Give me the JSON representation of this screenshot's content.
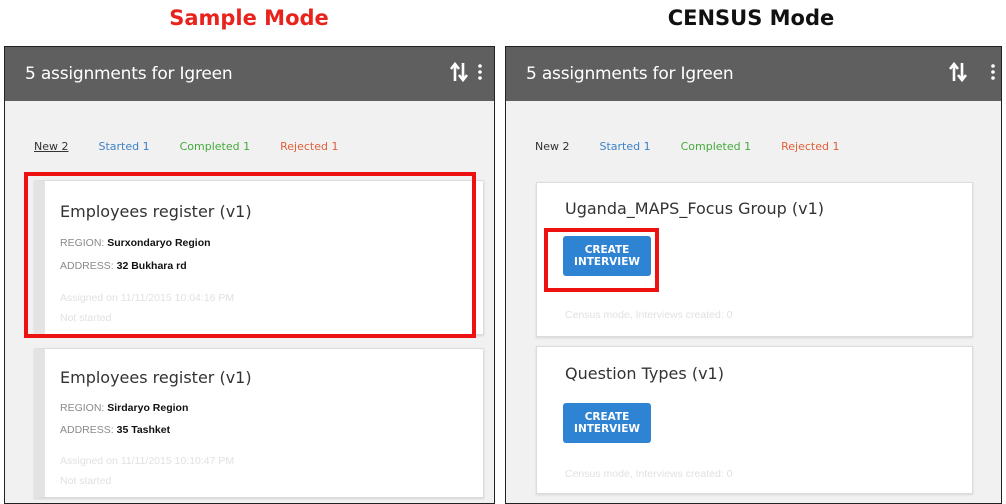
{
  "captions": {
    "sample": "Sample Mode",
    "census": "CENSUS Mode"
  },
  "colors": {
    "appbar": "#5f5f5f",
    "started": "#3c82c8",
    "completed": "#44aa3a",
    "rejected": "#e0603a",
    "button": "#2f83d3",
    "highlight": "#ee1111"
  },
  "sample": {
    "title": "5 assignments for Igreen",
    "tabs": {
      "new": "New 2",
      "started": "Started 1",
      "completed": "Completed 1",
      "rejected": "Rejected 1"
    },
    "cards": [
      {
        "title": "Employees register (v1)",
        "region_label": "REGION:",
        "region": "Surxondaryo Region",
        "address_label": "ADDRESS:",
        "address": "32 Bukhara rd",
        "assigned": "Assigned on 11/11/2015 10:04:16 PM",
        "status": "Not started"
      },
      {
        "title": "Employees register (v1)",
        "region_label": "REGION:",
        "region": "Sirdaryo Region",
        "address_label": "ADDRESS:",
        "address": "35 Tashket",
        "assigned": "Assigned on 11/11/2015 10:10:47 PM",
        "status": "Not started"
      }
    ]
  },
  "census": {
    "title": "5 assignments for Igreen",
    "tabs": {
      "new": "New 2",
      "started": "Started 1",
      "completed": "Completed 1",
      "rejected": "Rejected 1"
    },
    "cards": [
      {
        "title": "Uganda_MAPS_Focus Group (v1)",
        "button_line1": "CREATE",
        "button_line2": "INTERVIEW",
        "footer": "Census mode, Interviews created: 0"
      },
      {
        "title": "Question Types (v1)",
        "button_line1": "CREATE",
        "button_line2": "INTERVIEW",
        "footer": "Census mode, Interviews created: 0"
      }
    ]
  },
  "icons": {
    "sync": "sync-arrows-icon",
    "more": "more-vert-icon"
  }
}
